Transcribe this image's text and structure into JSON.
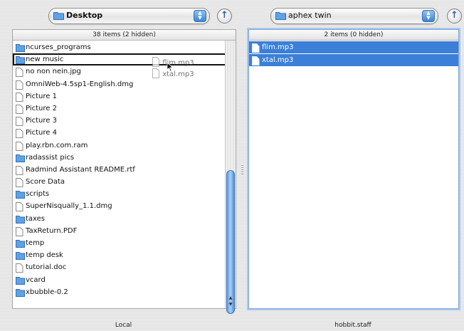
{
  "left": {
    "location": "Desktop",
    "count_label": "38 items (2 hidden)",
    "footer": "Local",
    "items": [
      {
        "name": "ncurses_programs",
        "kind": "folder"
      },
      {
        "name": "new music",
        "kind": "folder"
      },
      {
        "name": "no non nein.jpg",
        "kind": "file"
      },
      {
        "name": "OmniWeb-4.5sp1-English.dmg",
        "kind": "file"
      },
      {
        "name": "Picture 1",
        "kind": "file"
      },
      {
        "name": "Picture 2",
        "kind": "file"
      },
      {
        "name": "Picture 3",
        "kind": "file"
      },
      {
        "name": "Picture 4",
        "kind": "file"
      },
      {
        "name": "play.rbn.com.ram",
        "kind": "file"
      },
      {
        "name": "radassist pics",
        "kind": "folder"
      },
      {
        "name": "Radmind Assistant README.rtf",
        "kind": "file"
      },
      {
        "name": "Score Data",
        "kind": "file"
      },
      {
        "name": "scripts",
        "kind": "folder"
      },
      {
        "name": "SuperNisqually_1.1.dmg",
        "kind": "file"
      },
      {
        "name": "taxes",
        "kind": "folder"
      },
      {
        "name": "TaxReturn.PDF",
        "kind": "file"
      },
      {
        "name": "temp",
        "kind": "folder"
      },
      {
        "name": "temp desk",
        "kind": "folder"
      },
      {
        "name": "tutorial.doc",
        "kind": "file"
      },
      {
        "name": "vcard",
        "kind": "folder"
      },
      {
        "name": "xbubble-0.2",
        "kind": "folder"
      }
    ],
    "drag_ghost": [
      "flim.mp3",
      "xtal.mp3"
    ]
  },
  "right": {
    "location": "aphex twin",
    "count_label": "2 items (0 hidden)",
    "footer": "hobbit.staff",
    "items": [
      {
        "name": "flim.mp3",
        "kind": "file"
      },
      {
        "name": "xtal.mp3",
        "kind": "file"
      }
    ]
  },
  "colors": {
    "selection": "#3b7fd8",
    "folder": "#5fa2e6",
    "scroll_thumb": "#5d9de3"
  },
  "icons": {
    "up": "up-arrow-icon",
    "popup": "updown-arrows-icon",
    "folder": "folder-icon",
    "file": "document-icon"
  }
}
